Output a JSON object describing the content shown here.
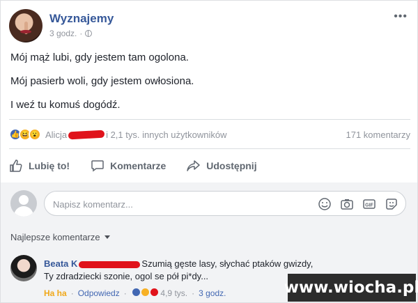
{
  "post": {
    "page_name": "Wyznajemy",
    "time": "3 godz.",
    "more_label": "•••",
    "lines": [
      "Mój mąż lubi, gdy jestem tam ogolona.",
      "Mój pasierb woli, gdy jestem owłosiona.",
      "I weź tu komuś dogódź."
    ]
  },
  "reactions": {
    "first_name": "Alicja",
    "others": "i 2,1 tys. innych użytkowników",
    "comments_count": "171 komentarzy",
    "icons": [
      "like-icon",
      "haha-icon",
      "wow-icon"
    ],
    "colors": {
      "like": "#4267b2",
      "emoji": "#f7b125"
    }
  },
  "actions": {
    "like": "Lubię to!",
    "comment": "Komentarze",
    "share": "Udostępnij"
  },
  "comment_box": {
    "placeholder": "Napisz komentarz...",
    "icons": [
      "emoji-icon",
      "camera-icon",
      "gif-icon",
      "sticker-icon"
    ]
  },
  "comments_filter": "Najlepsze komentarze",
  "top_comment": {
    "author": "Beata K",
    "text_line1": "Szumią gęste lasy, słychać ptaków gwizdy,",
    "text_line2": "Ty zdradziecki szonie, ogol se pół pi*dy...",
    "haha": "Ha ha",
    "dot": "·",
    "reply": "Odpowiedz",
    "reaction_count": "4,9 tys.",
    "time": "3 godz."
  },
  "watermark": "www.wiocha.pl",
  "theme": {
    "link": "#365899",
    "muted": "#90949c",
    "redaction": "#e0131b"
  }
}
